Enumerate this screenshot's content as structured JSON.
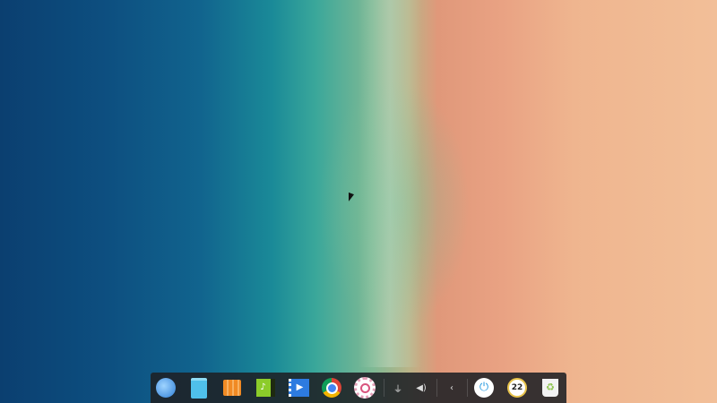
{
  "desktop": {
    "wallpaper": "beach-aerial"
  },
  "dock": {
    "apps": [
      {
        "name": "launcher",
        "color": "#3a8fe0"
      },
      {
        "name": "file-manager",
        "color": "#4fc0ea"
      },
      {
        "name": "app-store",
        "color": "#f08a24"
      },
      {
        "name": "music",
        "color": "#8ccc2a"
      },
      {
        "name": "movie",
        "color": "#2d7be0"
      },
      {
        "name": "chrome",
        "color": "#db4437"
      },
      {
        "name": "settings",
        "color": "#e4a0b8"
      }
    ],
    "tray": {
      "usb": "usb-icon",
      "volume": "volume-icon",
      "expand": "chevron-left-icon"
    },
    "shutdown": {
      "color": "#2a9be0"
    },
    "clock": {
      "text": "22"
    },
    "trash": {
      "color": "#8bc34a"
    }
  }
}
